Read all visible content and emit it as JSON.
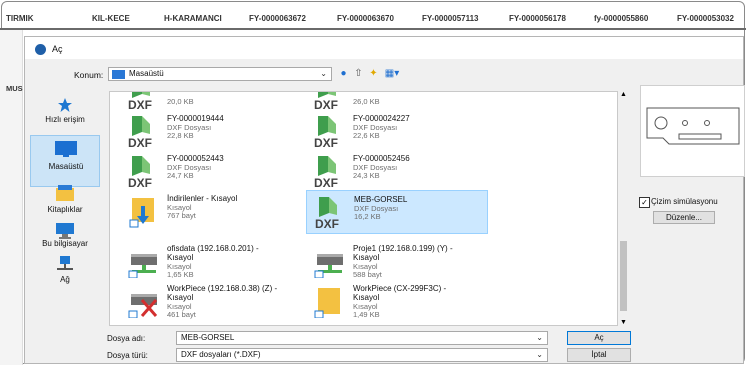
{
  "background_header": {
    "cells": [
      "TIRMIK",
      "KIL-KECE",
      "H-KARAMANCI",
      "FY-0000063672",
      "FY-0000063670",
      "FY-0000057113",
      "FY-0000056178",
      "fy-0000055860",
      "FY-0000053032"
    ],
    "side_label": "MUS"
  },
  "dialog": {
    "title": "Aç",
    "location": {
      "label": "Konum:",
      "value": "Masaüstü"
    },
    "places": [
      {
        "label": "Hızlı erişim",
        "icon": "star-icon"
      },
      {
        "label": "Masaüstü",
        "icon": "desktop-icon",
        "selected": true
      },
      {
        "label": "Kitaplıklar",
        "icon": "libraries-icon"
      },
      {
        "label": "Bu bilgisayar",
        "icon": "computer-icon"
      },
      {
        "label": "Ağ",
        "icon": "network-icon"
      }
    ],
    "files": [
      {
        "name": "",
        "name2": "",
        "type": "",
        "size": "20,0 KB",
        "icon": "dxf-icon"
      },
      {
        "name": "",
        "name2": "",
        "type": "",
        "size": "26,0 KB",
        "icon": "dxf-icon"
      },
      {
        "name": "FY-0000019444",
        "name2": "",
        "type": "DXF Dosyası",
        "size": "22,8 KB",
        "icon": "dxf-icon"
      },
      {
        "name": "FY-0000024227",
        "name2": "",
        "type": "DXF Dosyası",
        "size": "22,6 KB",
        "icon": "dxf-icon"
      },
      {
        "name": "FY-0000052443",
        "name2": "",
        "type": "DXF Dosyası",
        "size": "24,7 KB",
        "icon": "dxf-icon"
      },
      {
        "name": "FY-0000052456",
        "name2": "",
        "type": "DXF Dosyası",
        "size": "24,3 KB",
        "icon": "dxf-icon"
      },
      {
        "name": "İndirilenler - Kısayol",
        "name2": "",
        "type": "Kısayol",
        "size": "767 bayt",
        "icon": "downloads-shortcut-icon"
      },
      {
        "name": "MEB-GORSEL",
        "name2": "",
        "type": "DXF Dosyası",
        "size": "16,2 KB",
        "icon": "dxf-icon",
        "selected": true
      },
      {
        "name": "ofisdata (192.168.0.201) -",
        "name2": "Kısayol",
        "type": "Kısayol",
        "size": "1,65 KB",
        "icon": "network-drive-icon"
      },
      {
        "name": "Proje1 (192.168.0.199) (Y) -",
        "name2": "Kısayol",
        "type": "Kısayol",
        "size": "588 bayt",
        "icon": "network-drive-icon"
      },
      {
        "name": "WorkPiece (192.168.0.38) (Z) -",
        "name2": "Kısayol",
        "type": "Kısayol",
        "size": "461 bayt",
        "icon": "disconnected-drive-icon"
      },
      {
        "name": "WorkPiece (CX-299F3C) -",
        "name2": "Kısayol",
        "type": "Kısayol",
        "size": "1,49 KB",
        "icon": "folder-shortcut-icon"
      }
    ],
    "preview": {
      "simulation_label": "Çizim simülasyonu",
      "simulation_checked": true,
      "edit_button": "Düzenle..."
    },
    "filename": {
      "label": "Dosya adı:",
      "value": "MEB-GORSEL"
    },
    "filetype": {
      "label": "Dosya türü:",
      "value": "DXF dosyaları (*.DXF)"
    },
    "open_button": "Aç",
    "cancel_button": "İptal"
  },
  "colors": {
    "selection": "#cce8ff",
    "accent": "#0078d7",
    "folder": "#f3c141",
    "dxf_green": "#4caf50"
  }
}
